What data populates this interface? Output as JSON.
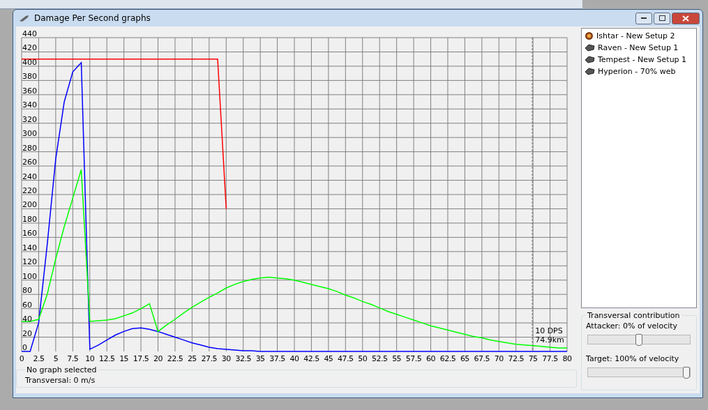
{
  "window": {
    "title": "Damage Per Second graphs"
  },
  "graph": {
    "chart_data": {
      "type": "line",
      "grid": true,
      "x": [
        0,
        1.25,
        2.5,
        3.75,
        5,
        6.25,
        7.5,
        8.75,
        10,
        11.25,
        12.5,
        13.75,
        15,
        16.25,
        17.5,
        18.75,
        20,
        21.25,
        22.5,
        23.75,
        25,
        26.25,
        27.5,
        28.75,
        30,
        31.25,
        32.5,
        33.75,
        35,
        36.25,
        37.5,
        38.75,
        40,
        41.25,
        42.5,
        43.75,
        45,
        46.25,
        47.5,
        48.75,
        50,
        51.25,
        52.5,
        53.75,
        55,
        56.25,
        57.5,
        58.75,
        60,
        61.25,
        62.5,
        63.75,
        65,
        66.25,
        67.5,
        68.75,
        70,
        71.25,
        72.5,
        73.75,
        75,
        76.25,
        77.5,
        78.75,
        80
      ],
      "series": [
        {
          "color": "#ff0000",
          "values": [
            410,
            410,
            410,
            410,
            410,
            410,
            410,
            410,
            410,
            410,
            410,
            410,
            410,
            410,
            410,
            410,
            410,
            410,
            410,
            410,
            410,
            410,
            410,
            410,
            200,
            null,
            null,
            null,
            null,
            null,
            null,
            null,
            null,
            null,
            null,
            null,
            null,
            null,
            null,
            null,
            null,
            null,
            null,
            null,
            null,
            null,
            null,
            null,
            null,
            null,
            null,
            null,
            null,
            null,
            null,
            null,
            null,
            null,
            null,
            null,
            null,
            null,
            null,
            null,
            null
          ]
        },
        {
          "color": "#0000ff",
          "values": [
            0,
            0,
            40,
            150,
            270,
            350,
            392,
            405,
            3,
            9,
            16,
            23,
            28,
            32,
            33,
            31,
            28,
            24,
            20,
            16,
            12,
            9,
            6,
            4,
            3,
            2,
            1,
            1,
            0,
            0,
            0,
            0,
            0,
            0,
            0,
            0,
            0,
            0,
            0,
            0,
            0,
            0,
            0,
            0,
            0,
            0,
            0,
            0,
            0,
            0,
            0,
            0,
            0,
            0,
            0,
            0,
            0,
            0,
            0,
            0,
            0,
            0,
            0,
            0,
            0
          ]
        },
        {
          "color": "#00ff00",
          "values": [
            42,
            42,
            45,
            80,
            130,
            175,
            215,
            255,
            42,
            43,
            44,
            46,
            50,
            54,
            60,
            67,
            28,
            37,
            45,
            54,
            62,
            69,
            76,
            82,
            89,
            94,
            98,
            101,
            103,
            104,
            103,
            102,
            100,
            97,
            94,
            91,
            88,
            84,
            79,
            75,
            70,
            66,
            61,
            56,
            52,
            48,
            44,
            40,
            36,
            33,
            30,
            27,
            24,
            21,
            19,
            16,
            14,
            12,
            10,
            9,
            8,
            7,
            6,
            5,
            5
          ]
        }
      ],
      "xlim": [
        0,
        80
      ],
      "ylim": [
        0,
        440
      ],
      "xticks": [
        0,
        2.5,
        5,
        7.5,
        10,
        12.5,
        15,
        17.5,
        20,
        22.5,
        25,
        27.5,
        30,
        32.5,
        35,
        37.5,
        40,
        42.5,
        45,
        47.5,
        50,
        52.5,
        55,
        57.5,
        60,
        62.5,
        65,
        67.5,
        70,
        72.5,
        75,
        77.5,
        80
      ],
      "yticks": [
        0,
        20,
        40,
        60,
        80,
        100,
        120,
        140,
        160,
        180,
        200,
        220,
        240,
        260,
        280,
        300,
        320,
        340,
        360,
        380,
        400,
        420,
        440
      ],
      "ref_lines": [
        {
          "axis": "x",
          "value": 74.9
        }
      ],
      "annotations": [
        {
          "x": 74.9,
          "y": 10,
          "text": "10 DPS"
        },
        {
          "x": 74.9,
          "y": 10,
          "text": "74.9km"
        }
      ]
    }
  },
  "status": {
    "title": "No graph selected",
    "text": "Transversal: 0 m/s"
  },
  "fits": [
    {
      "label": "Ishtar - New Setup 2",
      "kind": "drone"
    },
    {
      "label": "Raven - New Setup 1",
      "kind": "ship"
    },
    {
      "label": "Tempest - New Setup 1",
      "kind": "ship"
    },
    {
      "label": "Hyperion - 70% web",
      "kind": "ship"
    }
  ],
  "transversal": {
    "title": "Transversal contribution",
    "sliders": [
      {
        "label": "Attacker: 0% of velocity",
        "level": 0.5
      },
      {
        "label": "Target: 100% of velocity",
        "level": 1
      }
    ]
  }
}
